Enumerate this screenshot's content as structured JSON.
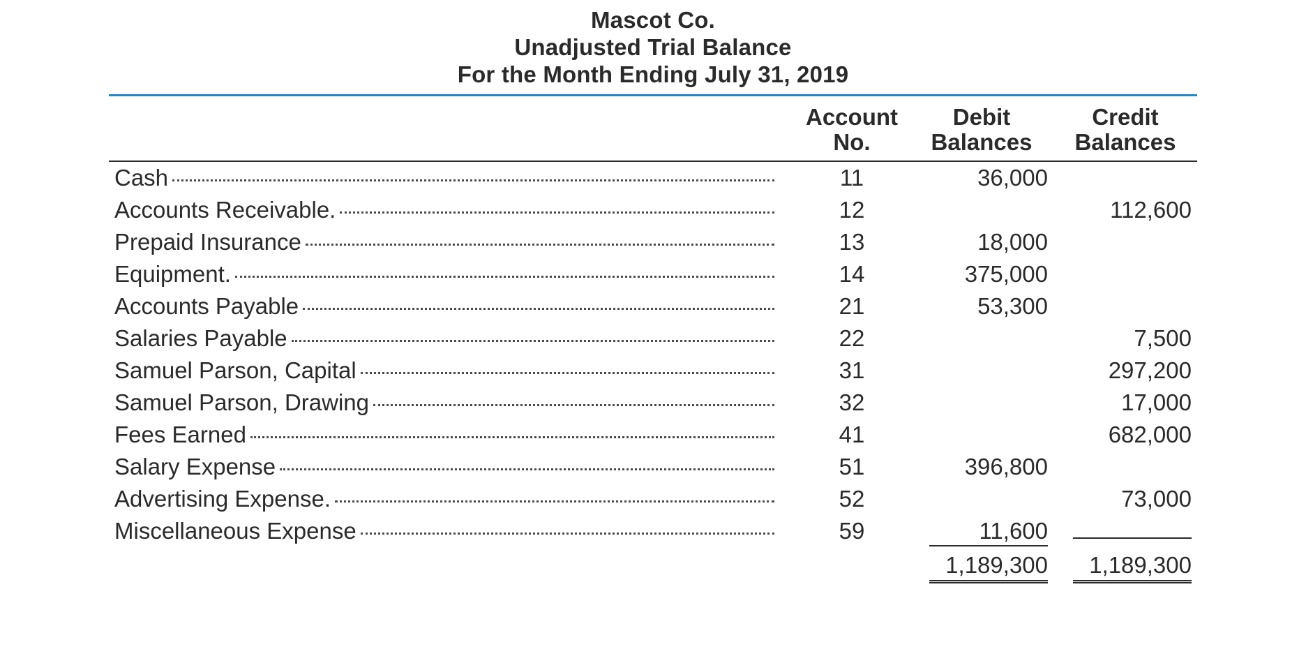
{
  "header": {
    "company": "Mascot Co.",
    "report": "Unadjusted Trial Balance",
    "period": "For the Month Ending July 31, 2019"
  },
  "columns": {
    "name": "",
    "account_no_line1": "Account",
    "account_no_line2": "No.",
    "debit_line1": "Debit",
    "debit_line2": "Balances",
    "credit_line1": "Credit",
    "credit_line2": "Balances"
  },
  "rows": [
    {
      "name": "Cash",
      "account_no": "11",
      "debit": "36,000",
      "credit": ""
    },
    {
      "name": "Accounts Receivable.",
      "account_no": "12",
      "debit": "",
      "credit": "112,600"
    },
    {
      "name": "Prepaid Insurance",
      "account_no": "13",
      "debit": "18,000",
      "credit": ""
    },
    {
      "name": "Equipment.",
      "account_no": "14",
      "debit": "375,000",
      "credit": ""
    },
    {
      "name": "Accounts Payable",
      "account_no": "21",
      "debit": "53,300",
      "credit": ""
    },
    {
      "name": "Salaries Payable",
      "account_no": "22",
      "debit": "",
      "credit": "7,500"
    },
    {
      "name": "Samuel Parson, Capital",
      "account_no": "31",
      "debit": "",
      "credit": "297,200"
    },
    {
      "name": "Samuel Parson, Drawing",
      "account_no": "32",
      "debit": "",
      "credit": "17,000"
    },
    {
      "name": "Fees Earned",
      "account_no": "41",
      "debit": "",
      "credit": "682,000"
    },
    {
      "name": "Salary Expense",
      "account_no": "51",
      "debit": "396,800",
      "credit": ""
    },
    {
      "name": "Advertising Expense.",
      "account_no": "52",
      "debit": "",
      "credit": "73,000"
    },
    {
      "name": "Miscellaneous Expense",
      "account_no": "59",
      "debit": "11,600",
      "credit": ""
    }
  ],
  "totals": {
    "debit": "1,189,300",
    "credit": "1,189,300"
  }
}
